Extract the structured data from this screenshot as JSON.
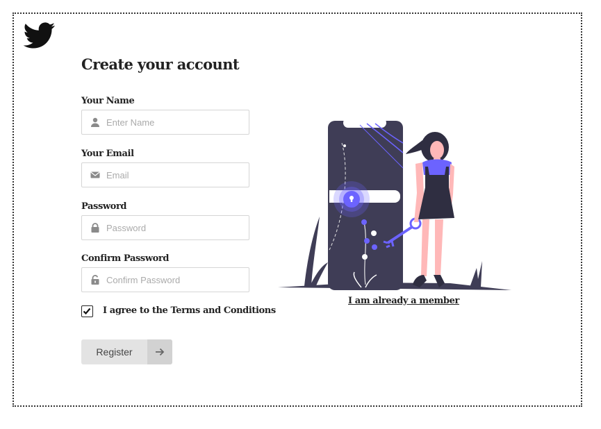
{
  "brand": {
    "logo_icon": "twitter-bird-icon"
  },
  "form": {
    "title": "Create your account",
    "fields": [
      {
        "label": "Your Name",
        "placeholder": "Enter Name",
        "icon": "user-icon",
        "value": ""
      },
      {
        "label": "Your Email",
        "placeholder": "Email",
        "icon": "envelope-icon",
        "value": ""
      },
      {
        "label": "Password",
        "placeholder": "Password",
        "icon": "lock-icon",
        "value": ""
      },
      {
        "label": "Confirm Password",
        "placeholder": "Confirm Password",
        "icon": "lock-open-icon",
        "value": ""
      }
    ],
    "terms": {
      "label": "I agree to the Terms and Conditions",
      "checked": true
    },
    "register_label": "Register",
    "register_icon": "arrow-right-icon"
  },
  "illustration": {
    "icon": "phone-key-woman-illustration",
    "accent": "#6c63ff",
    "dark": "#3f3d56"
  },
  "login_link": "I am already a member"
}
